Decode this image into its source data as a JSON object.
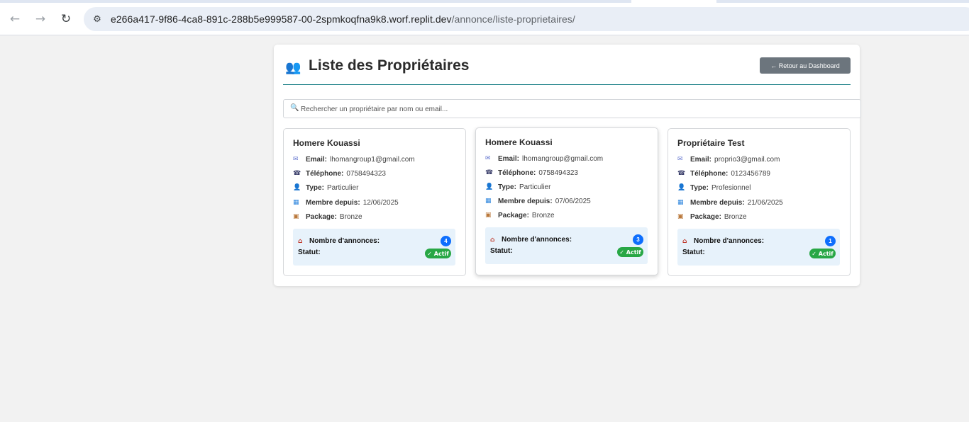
{
  "browser": {
    "url_host": "e266a417-9f86-4ca8-891c-288b5e999587-00-2spmkoqfna9k8.worf.replit.dev",
    "url_path": "/annonce/liste-proprietaires/"
  },
  "header": {
    "title": "Liste des Propriétaires",
    "back_button": "← Retour au Dashboard"
  },
  "search": {
    "placeholder": "Rechercher un propriétaire par nom ou email..."
  },
  "labels": {
    "email": "Email:",
    "phone": "Téléphone:",
    "type": "Type:",
    "member_since": "Membre depuis:",
    "package": "Package:",
    "listings_count": "Nombre d'annonces:",
    "status": "Statut:"
  },
  "owners": [
    {
      "name": "Homere Kouassi",
      "email": "lhomangroup1@gmail.com",
      "phone": "0758494323",
      "type": "Particulier",
      "member_since": "12/06/2025",
      "package": "Bronze",
      "listings": "4",
      "status": "✓ Actif"
    },
    {
      "name": "Homere Kouassi",
      "email": "lhomangroup@gmail.com",
      "phone": "0758494323",
      "type": "Particulier",
      "member_since": "07/06/2025",
      "package": "Bronze",
      "listings": "3",
      "status": "✓ Actif"
    },
    {
      "name": "Propriétaire Test",
      "email": "proprio3@gmail.com",
      "phone": "0123456789",
      "type": "Profesionnel",
      "member_since": "21/06/2025",
      "package": "Bronze",
      "listings": "1",
      "status": "✓ Actif"
    }
  ],
  "icons": {
    "title": "people-icon",
    "email": "email-icon",
    "phone": "phone-icon",
    "type": "user-icon",
    "member_since": "calendar-icon",
    "package": "package-icon",
    "listings": "house-icon",
    "search": "search-icon"
  },
  "colors": {
    "accent_rule": "#1a7f86",
    "back_button": "#6c757d",
    "count_badge": "#0d6efd",
    "status_badge": "#28a745",
    "stats_bg": "#e7f2fb"
  }
}
